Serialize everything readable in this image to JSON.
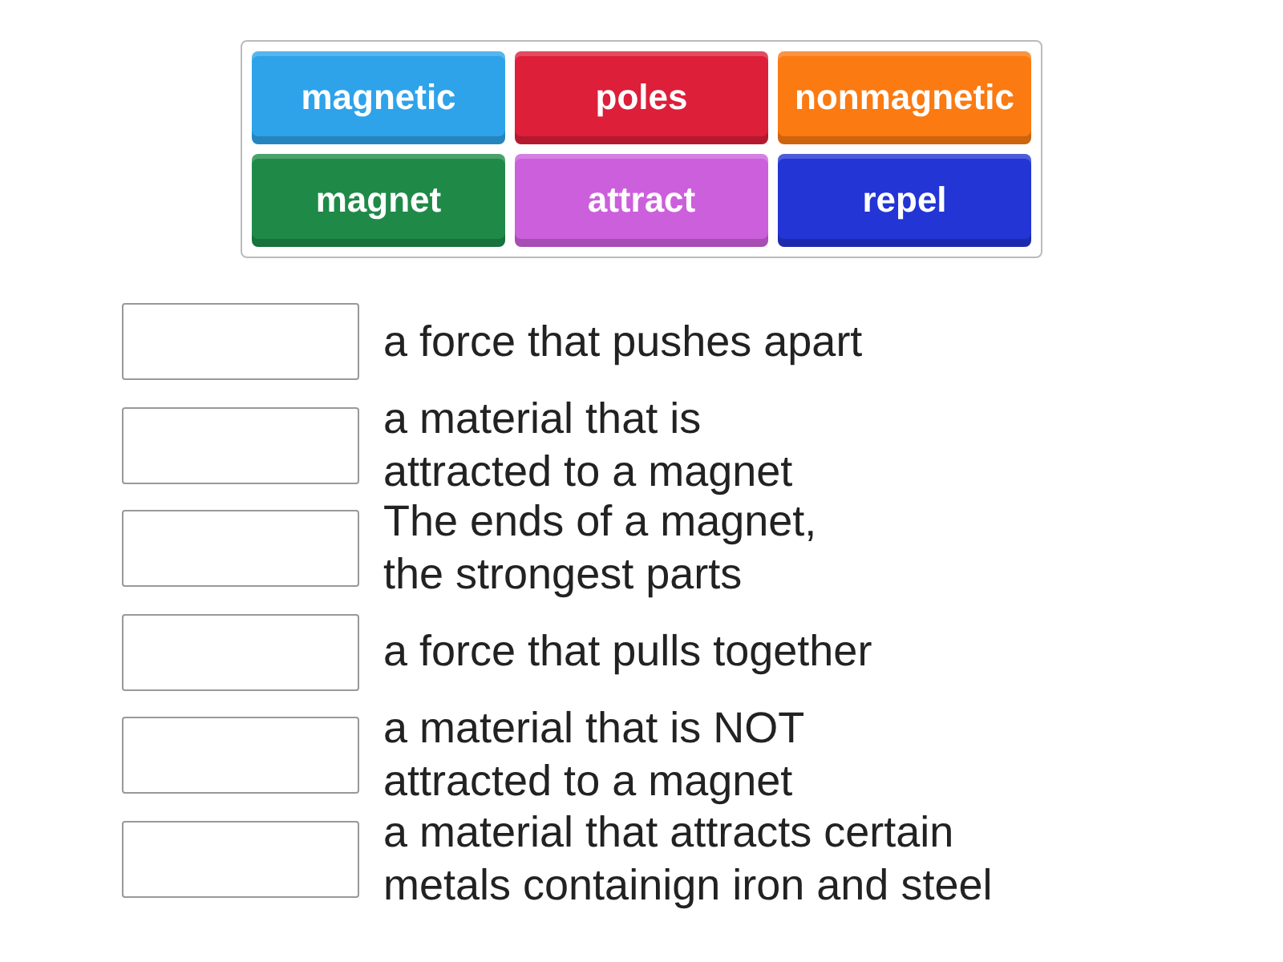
{
  "tiles": [
    {
      "label": "magnetic",
      "color": "#2ea3ea"
    },
    {
      "label": "poles",
      "color": "#dd1f3a"
    },
    {
      "label": "nonmagnetic",
      "color": "#fb7a12"
    },
    {
      "label": "magnet",
      "color": "#1f8a48"
    },
    {
      "label": "attract",
      "color": "#cc5fdc"
    },
    {
      "label": "repel",
      "color": "#2335d4"
    }
  ],
  "definitions": [
    {
      "text": "a force that pushes apart"
    },
    {
      "text": "a material that is\nattracted to a magnet"
    },
    {
      "text": "The ends of a magnet,\nthe strongest parts"
    },
    {
      "text": "a force that pulls together"
    },
    {
      "text": "a material that is NOT\nattracted to a magnet"
    },
    {
      "text": "a material that attracts certain\nmetals containign iron and steel"
    }
  ]
}
